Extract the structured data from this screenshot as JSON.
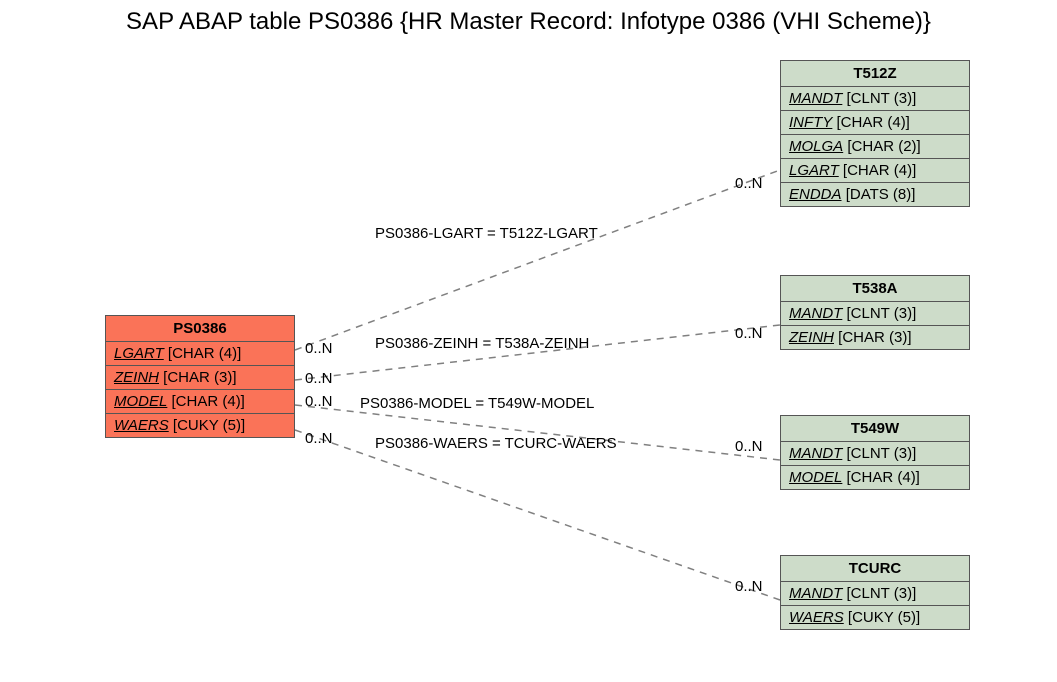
{
  "title": "SAP ABAP table PS0386 {HR Master Record: Infotype 0386 (VHI Scheme)}",
  "main_entity": {
    "name": "PS0386",
    "fields": [
      {
        "key": "LGART",
        "type": "[CHAR (4)]"
      },
      {
        "key": "ZEINH",
        "type": "[CHAR (3)]"
      },
      {
        "key": "MODEL",
        "type": "[CHAR (4)]"
      },
      {
        "key": "WAERS",
        "type": "[CUKY (5)]"
      }
    ]
  },
  "ref_entities": [
    {
      "id": "t512z",
      "name": "T512Z",
      "fields": [
        {
          "key": "MANDT",
          "type": "[CLNT (3)]"
        },
        {
          "key": "INFTY",
          "type": "[CHAR (4)]"
        },
        {
          "key": "MOLGA",
          "type": "[CHAR (2)]"
        },
        {
          "key": "LGART",
          "type": "[CHAR (4)]"
        },
        {
          "key": "ENDDA",
          "type": "[DATS (8)]"
        }
      ]
    },
    {
      "id": "t538a",
      "name": "T538A",
      "fields": [
        {
          "key": "MANDT",
          "type": "[CLNT (3)]"
        },
        {
          "key": "ZEINH",
          "type": "[CHAR (3)]"
        }
      ]
    },
    {
      "id": "t549w",
      "name": "T549W",
      "fields": [
        {
          "key": "MANDT",
          "type": "[CLNT (3)]"
        },
        {
          "key": "MODEL",
          "type": "[CHAR (4)]"
        }
      ]
    },
    {
      "id": "tcurc",
      "name": "TCURC",
      "fields": [
        {
          "key": "MANDT",
          "type": "[CLNT (3)]"
        },
        {
          "key": "WAERS",
          "type": "[CUKY (5)]"
        }
      ]
    }
  ],
  "edges": [
    {
      "label": "PS0386-LGART = T512Z-LGART",
      "card_left": "0..N",
      "card_right": "0..N"
    },
    {
      "label": "PS0386-ZEINH = T538A-ZEINH",
      "card_left": "0..N",
      "card_right": "0..N"
    },
    {
      "label": "PS0386-MODEL = T549W-MODEL",
      "card_left": "0..N",
      "card_right": ""
    },
    {
      "label": "PS0386-WAERS = TCURC-WAERS",
      "card_left": "0..N",
      "card_right": "0..N"
    }
  ],
  "extra_cards": {
    "tcurc": "0..N"
  }
}
